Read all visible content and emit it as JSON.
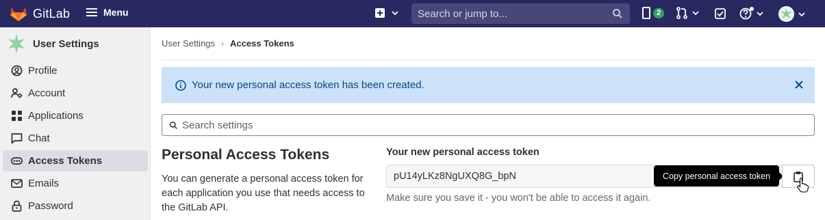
{
  "topbar": {
    "brand": "GitLab",
    "menu_label": "Menu",
    "search_placeholder": "Search or jump to...",
    "issues_count": "2",
    "colors": {
      "bg": "#292961",
      "badge": "#2da160"
    }
  },
  "sidebar": {
    "title": "User Settings",
    "items": [
      {
        "label": "Profile",
        "icon": "profile-icon"
      },
      {
        "label": "Account",
        "icon": "account-icon"
      },
      {
        "label": "Applications",
        "icon": "applications-icon"
      },
      {
        "label": "Chat",
        "icon": "chat-icon"
      },
      {
        "label": "Access Tokens",
        "icon": "token-icon",
        "active": true
      },
      {
        "label": "Emails",
        "icon": "mail-icon"
      },
      {
        "label": "Password",
        "icon": "lock-icon"
      }
    ]
  },
  "breadcrumb": {
    "parent": "User Settings",
    "separator": "›",
    "current": "Access Tokens"
  },
  "alert": {
    "message": "Your new personal access token has been created."
  },
  "settings_search": {
    "placeholder": "Search settings"
  },
  "section": {
    "title": "Personal Access Tokens",
    "description": "You can generate a personal access token for each application you use that needs access to the GitLab API."
  },
  "token": {
    "label": "Your new personal access token",
    "value": "pU14yLKz8NgUXQ8G_bpN",
    "tooltip": "Copy personal access token",
    "help": "Make sure you save it - you won't be able to access it again."
  }
}
